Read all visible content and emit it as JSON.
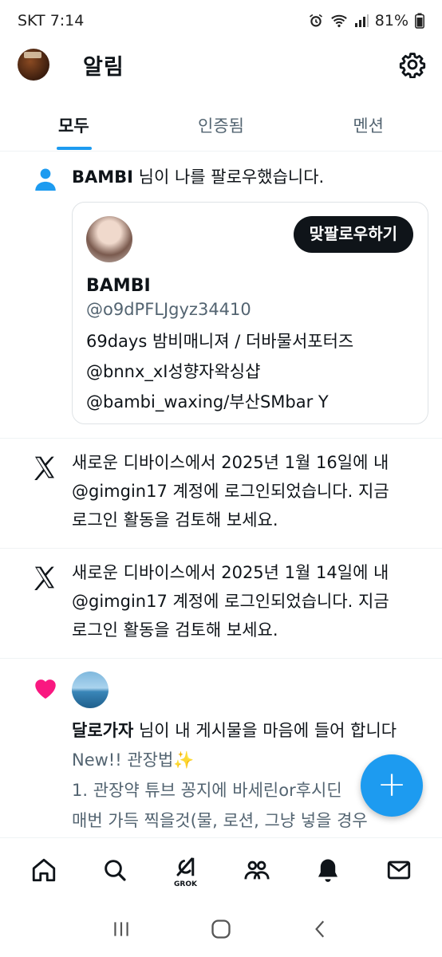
{
  "status": {
    "carrier_time": "SKT 7:14",
    "battery": "81%"
  },
  "header": {
    "title": "알림"
  },
  "tabs": [
    {
      "label": "모두"
    },
    {
      "label": "인증됨"
    },
    {
      "label": "멘션"
    }
  ],
  "follow_notification": {
    "name": "BAMBI",
    "text": " 님이 나를 팔로우했습니다.",
    "card": {
      "follow_back_label": "맞팔로우하기",
      "name": "BAMBI",
      "handle": "@o9dPFLJgyz34410",
      "bio": [
        "69days 밤비매니져 / 더바물서포터즈",
        "@bnnx_xI성향자왁싱샵",
        "@bambi_waxing/부산SMbar Y"
      ]
    }
  },
  "login_notifications": [
    {
      "lines": [
        "새로운 디바이스에서 2025년 1월 16일에 내",
        "@gimgin17 계정에 로그인되었습니다. 지금",
        "로그인 활동을 검토해 보세요."
      ]
    },
    {
      "lines": [
        "새로운 디바이스에서 2025년 1월 14일에 내",
        "@gimgin17 계정에 로그인되었습니다. 지금",
        "로그인 활동을 검토해 보세요."
      ]
    }
  ],
  "like_notification": {
    "name": "달로가자",
    "text": " 님이 내 게시물을 마음에 들어 합니다",
    "post_lines": [
      "New!! 관장법✨",
      "1. 관장약 튜브 꽁지에 바세린or후시딘",
      "매번 가득 찍을것(물, 로션, 그냥 넣을 경우"
    ]
  },
  "fab": {
    "label": "+"
  },
  "bottom_nav": {
    "grok_label": "GROK"
  },
  "colors": {
    "accent": "#1d9bf0",
    "like": "#f91880",
    "text": "#0f1419",
    "secondary": "#536471"
  }
}
